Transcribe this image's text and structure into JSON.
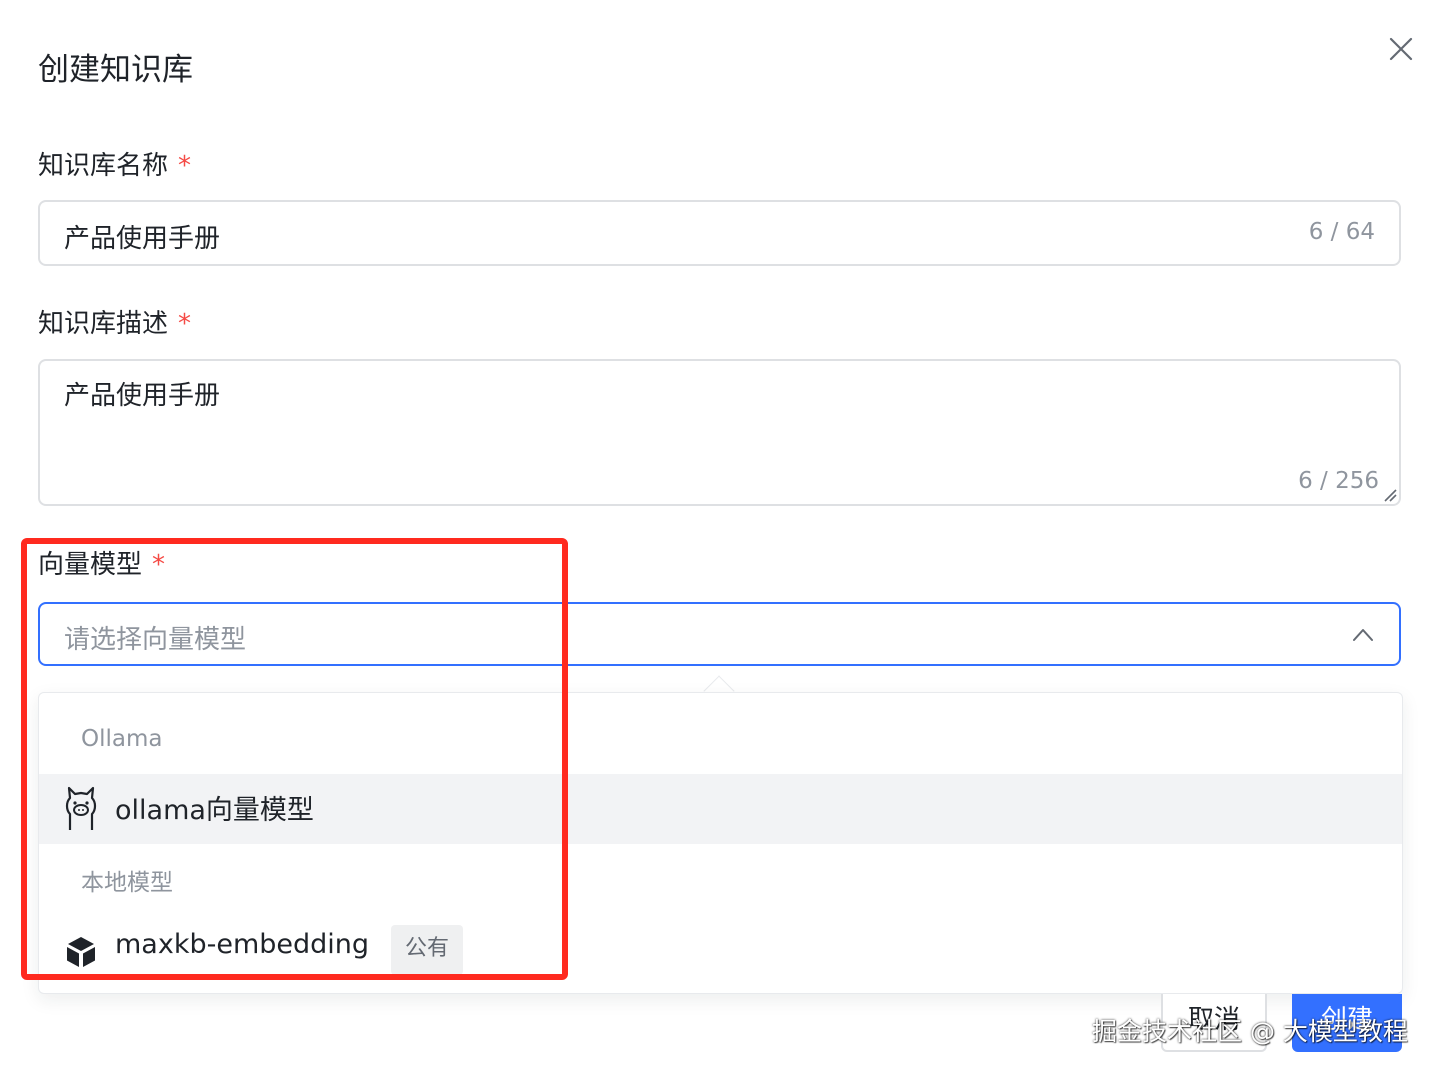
{
  "dialog": {
    "title": "创建知识库"
  },
  "icons": {
    "close": "close-icon",
    "chevron": "chevron-up-icon",
    "ollama": "llama-icon",
    "local": "cube-icon"
  },
  "colors": {
    "primary": "#3370ff",
    "required": "#f54a45",
    "highlight": "#ff2a1f"
  },
  "form": {
    "name": {
      "label": "知识库名称",
      "required_mark": "*",
      "value": "产品使用手册",
      "count": "6 / 64"
    },
    "description": {
      "label": "知识库描述",
      "required_mark": "*",
      "value": "产品使用手册",
      "count": "6 / 256"
    },
    "embedding": {
      "label": "向量模型",
      "required_mark": "*",
      "placeholder": "请选择向量模型",
      "open": true
    }
  },
  "dropdown": {
    "groups": [
      {
        "label": "Ollama",
        "options": [
          {
            "label": "ollama向量模型",
            "icon": "llama-icon",
            "hovered": true
          }
        ]
      },
      {
        "label": "本地模型",
        "options": [
          {
            "label": "maxkb-embedding",
            "icon": "cube-icon",
            "tag": "公有"
          }
        ]
      }
    ]
  },
  "footer": {
    "cancel_label": "取消",
    "create_label": "创建"
  },
  "watermark": "掘金技术社区 @ 大模型教程"
}
